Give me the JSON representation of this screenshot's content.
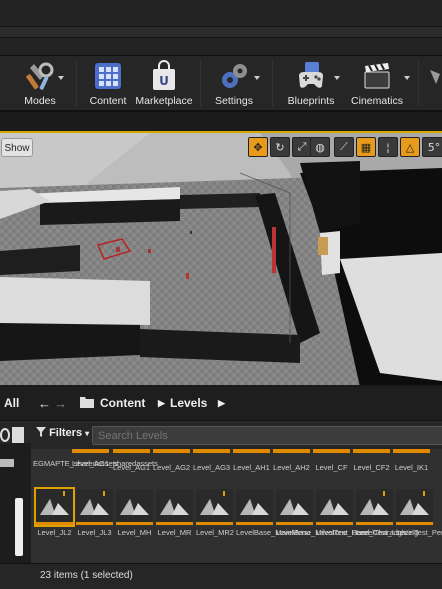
{
  "toolbar": {
    "modes": "Modes",
    "content": "Content",
    "marketplace": "Marketplace",
    "settings": "Settings",
    "blueprints": "Blueprints",
    "cinematics": "Cinematics"
  },
  "viewport": {
    "show_label": "Show",
    "snap_angle": "5°"
  },
  "content_browser": {
    "all_label": "All",
    "path": [
      "Content",
      "Levels"
    ],
    "filters_label": "Filters",
    "search_placeholder": "Search Levels",
    "status": "23 items (1 selected)",
    "top_row": [
      "EGMAPTE_sharedassets",
      "Level_AG1_sharedassets",
      "Level_AG1",
      "Level_AG2",
      "Level_AG3",
      "Level_AH1",
      "Level_AH2",
      "Level_CF",
      "Level_CF2",
      "Level_IK1"
    ],
    "bottom_row": [
      "Level_JL2",
      "Level_JL3",
      "Level_MH",
      "Level_MR",
      "Level_MR2",
      "LevelBase_MainMenu",
      "LevelBase_Milestone_Level",
      "LevelTest_Base_Character",
      "LevelTest_Lighting",
      "LevelTest_Persistent_Level"
    ]
  }
}
